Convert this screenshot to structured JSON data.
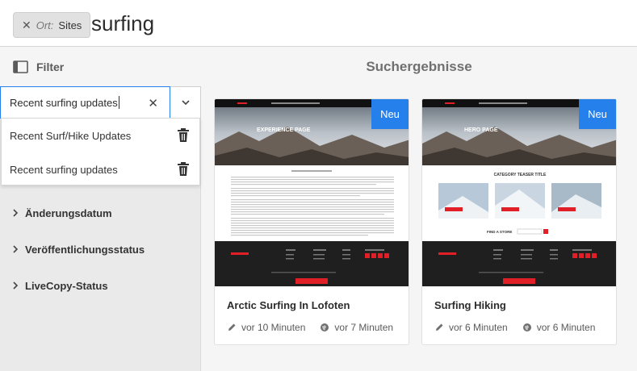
{
  "search": {
    "tag_prefix": "Ort:",
    "tag_value": "Sites",
    "query": "surfing"
  },
  "filter": {
    "title": "Filter",
    "input_value": "Recent surfing updates",
    "saved_searches": [
      {
        "label": "Recent Surf/Hike Updates"
      },
      {
        "label": "Recent surfing updates"
      }
    ],
    "facets": [
      {
        "label": "Änderungsdatum"
      },
      {
        "label": "Veröffentlichungsstatus"
      },
      {
        "label": "LiveCopy-Status"
      }
    ]
  },
  "results": {
    "title": "Suchergebnisse",
    "cards": [
      {
        "badge": "Neu",
        "hero_text": "EXPERIENCE PAGE",
        "title": "Arctic Surfing In Lofoten",
        "modified": "vor 10 Minuten",
        "published": "vor 7 Minuten"
      },
      {
        "badge": "Neu",
        "hero_text": "HERO PAGE",
        "section_title": "CATEGORY TEASER TITLE",
        "store_text": "FIND A STORE",
        "title": "Surfing Hiking",
        "modified": "vor 6 Minuten",
        "published": "vor 6 Minuten"
      }
    ]
  },
  "colors": {
    "accent": "#2680eb",
    "footer": "#1f1f1f",
    "brand_red": "#e01f26"
  }
}
